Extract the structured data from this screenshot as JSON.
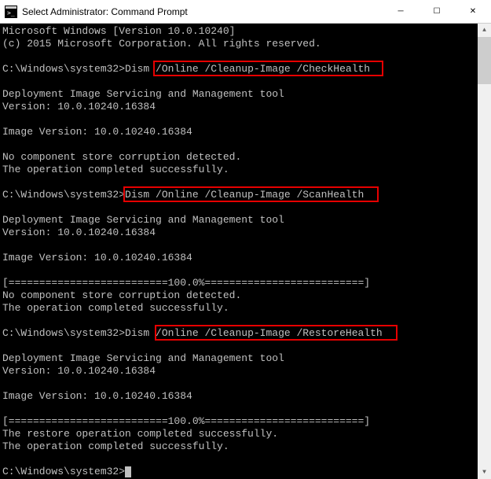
{
  "window": {
    "title": "Select Administrator: Command Prompt",
    "icon_name": "cmd-icon"
  },
  "controls": {
    "minimize": "─",
    "maximize": "☐",
    "close": "✕"
  },
  "terminal": {
    "header_line1": "Microsoft Windows [Version 10.0.10240]",
    "header_line2": "(c) 2015 Microsoft Corporation. All rights reserved.",
    "prompt": "C:\\Windows\\system32>",
    "cmd1_name": "Dism ",
    "cmd1_args": "/Online /Cleanup-Image /CheckHealth",
    "cmd2_full": "Dism /Online /Cleanup-Image /ScanHealth",
    "cmd3_name": "Dism ",
    "cmd3_args": "/Online /Cleanup-Image /RestoreHealth",
    "tool_line1": "Deployment Image Servicing and Management tool",
    "tool_line2": "Version: 10.0.10240.16384",
    "image_version": "Image Version: 10.0.10240.16384",
    "no_corruption": "No component store corruption detected.",
    "op_success": "The operation completed successfully.",
    "progress_bar": "[==========================100.0%==========================]",
    "restore_success": "The restore operation completed successfully."
  },
  "scrollbar": {
    "up": "▲",
    "down": "▼"
  }
}
